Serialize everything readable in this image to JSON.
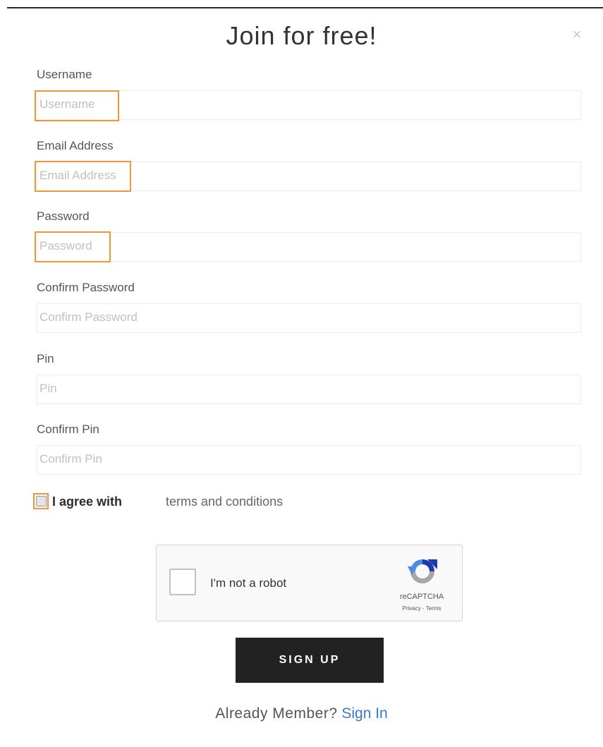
{
  "modal": {
    "title": "Join for free!",
    "close_symbol": "×"
  },
  "fields": [
    {
      "label": "Username",
      "placeholder": "Username"
    },
    {
      "label": "Email Address",
      "placeholder": "Email Address"
    },
    {
      "label": "Password",
      "placeholder": "Password"
    },
    {
      "label": "Confirm Password",
      "placeholder": "Confirm Password"
    },
    {
      "label": "Pin",
      "placeholder": "Pin"
    },
    {
      "label": "Confirm Pin",
      "placeholder": "Confirm Pin"
    }
  ],
  "agree": {
    "prefix": "I agree with",
    "link": "terms and conditions"
  },
  "captcha": {
    "label": "I'm not a robot",
    "brand": "reCAPTCHA",
    "links": "Privacy - Terms",
    "icon": "recaptcha-logo"
  },
  "signup_button": "SIGN UP",
  "footer": {
    "question": "Already Member?",
    "link": "Sign In"
  },
  "colors": {
    "highlight": "#f0963a",
    "link": "#3b78c6",
    "button_bg": "#222222"
  }
}
